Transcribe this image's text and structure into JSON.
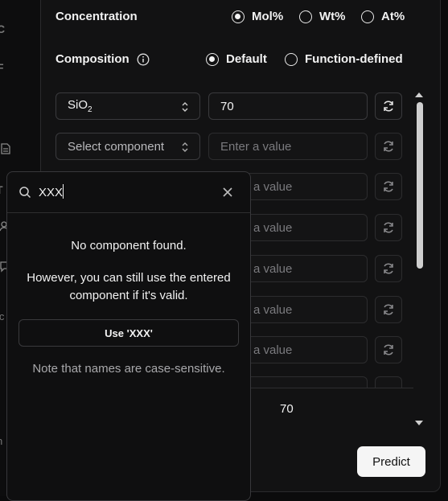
{
  "sidebar": {
    "fragments": [
      "C",
      "F",
      "I",
      "T",
      "ic",
      "n"
    ]
  },
  "form": {
    "concentration": {
      "label": "Concentration",
      "options": [
        "Mol%",
        "Wt%",
        "At%"
      ],
      "selected": "Mol%"
    },
    "composition": {
      "label": "Composition",
      "options": [
        "Default",
        "Function-defined"
      ],
      "selected": "Default"
    },
    "rows": [
      {
        "component": "SiO",
        "component_sub": "2",
        "value": "70"
      },
      {
        "component": "Select component",
        "value_placeholder": "Enter a value"
      },
      {
        "value_placeholder_partial": "a value"
      },
      {
        "value_placeholder_partial": "a value"
      },
      {
        "value_placeholder_partial": "a value"
      },
      {
        "value_placeholder_partial": "a value"
      },
      {
        "value_placeholder_partial": "a value"
      }
    ],
    "total": "70",
    "predict_label": "Predict"
  },
  "popover": {
    "search_value": "XXX",
    "no_result": "No component found.",
    "hint_line1": "However, you can still use the entered",
    "hint_line2": "component if it's valid.",
    "use_button": "Use 'XXX'",
    "note": "Note that names are case-sensitive."
  }
}
